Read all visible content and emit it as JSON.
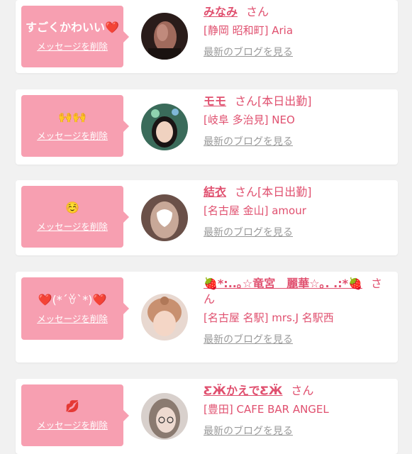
{
  "delete_label": "メッセージを削除",
  "blog_label": "最新のブログを見る",
  "items": [
    {
      "message": "すごくかわいい❤️",
      "name": "みなみ",
      "suffix": "さん",
      "status": "",
      "shop": "[静岡 昭和町] Aria"
    },
    {
      "message": "🙌🙌",
      "name": "モモ",
      "suffix": "さん",
      "status": "[本日出勤]",
      "shop": "[岐阜 多治見] NEO"
    },
    {
      "message": "☺️",
      "name": "結衣",
      "suffix": "さん",
      "status": "[本日出勤]",
      "shop": "[名古屋 金山] amour"
    },
    {
      "message": "❤️(*´ꈊ`*)❤️",
      "name": "🍓*:..｡☆竜宮　麗華☆｡. .:*🍓",
      "suffix": "さん",
      "status": "",
      "shop": "[名古屋 名駅] mrs.J 名駅西"
    },
    {
      "message": "💋",
      "name": "ƸӜかえでƸӜ",
      "suffix": "さん",
      "status": "",
      "shop": "[豊田] CAFE BAR ANGEL"
    }
  ],
  "colors": {
    "accent": "#e0506f",
    "bubble": "#f79fb1",
    "muted": "#9a9a9a",
    "background": "#f1f1f1"
  }
}
